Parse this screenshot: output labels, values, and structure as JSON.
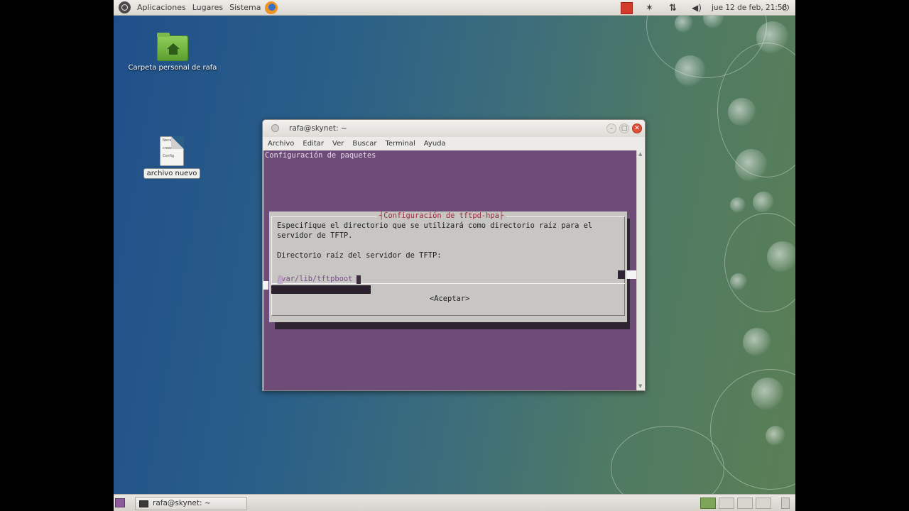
{
  "top_panel": {
    "menus": [
      "Aplicaciones",
      "Lugares",
      "Sistema"
    ],
    "datetime": "jue 12 de feb, 21:58",
    "icons": [
      "ubuntu-logo-icon",
      "firefox-icon",
      "red-app-icon",
      "bluetooth-icon",
      "network-icon",
      "volume-icon",
      "power-icon"
    ]
  },
  "desktop": {
    "home_folder_label": "Carpeta personal de rafa",
    "file_label": "archivo nuevo",
    "file_preview_lines": [
      "Necesito",
      "crear a",
      "Config"
    ]
  },
  "terminal": {
    "title": "rafa@skynet: ~",
    "menu": [
      "Archivo",
      "Editar",
      "Ver",
      "Buscar",
      "Terminal",
      "Ayuda"
    ],
    "header_line": "Configuración de paquetes",
    "dialog": {
      "title": "Configuración de tftpd-hpa",
      "text_line1": "Especifique el directorio que se utilizará como directorio raíz para el",
      "text_line2": "servidor de TFTP.",
      "prompt": "Directorio raíz del servidor de TFTP:",
      "input_value": "/var/lib/tftpboot",
      "button": "<Aceptar>"
    }
  },
  "bottom_panel": {
    "task_label": "rafa@skynet: ~"
  }
}
